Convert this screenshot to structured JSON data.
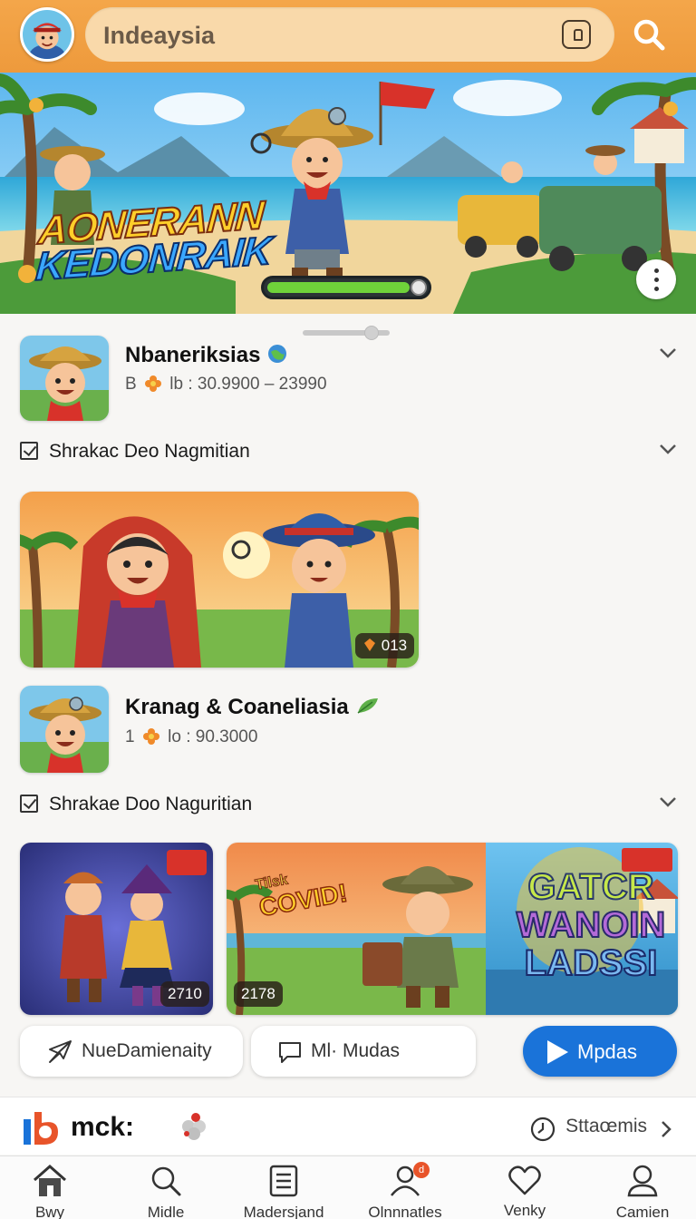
{
  "header": {
    "search_text": "Indeaysia"
  },
  "hero": {
    "title_line1": "AONERANN",
    "title_line2": "KEDONRAIK",
    "progress": 0.9
  },
  "items": [
    {
      "title": "Nbaneriksias",
      "meta_prefix": "B",
      "meta_value": "lb : 30.9900 – 23990",
      "check_label": "Shrakac Deo Nagmitian",
      "banner_badge": "013"
    },
    {
      "title": "Kranag & Coaneliasia",
      "meta_prefix": "1",
      "meta_value": "lo : 90.3000",
      "check_label": "Shrakae Doo Naguritian"
    }
  ],
  "gallery": [
    {
      "badge": "2710"
    },
    {
      "badge": "2178",
      "art_text": "COVID!",
      "art_small": "Tilsk"
    },
    {
      "art_text_1": "GATCR",
      "art_text_2": "WANOIN",
      "art_text_3": "LADSSI"
    }
  ],
  "actions": {
    "left_label": "NueDamienaity",
    "middle_label": "Ml· Mudas",
    "primary_label": "Mpdas"
  },
  "brand": {
    "name": "mck:",
    "status_link": "Sttaœmis"
  },
  "bottom_nav": [
    {
      "label": "Bwy",
      "icon": "home-icon"
    },
    {
      "label": "Midle",
      "icon": "search-icon"
    },
    {
      "label": "Madersjand",
      "icon": "document-icon"
    },
    {
      "label": "Olnnnatles",
      "icon": "person-icon",
      "badge": "d"
    },
    {
      "label": "Venky",
      "icon": "heart-icon"
    },
    {
      "label": "Camien",
      "icon": "user-icon"
    }
  ],
  "colors": {
    "header": "#ee9a3c",
    "primary": "#1a73d9",
    "progress": "#6fd23a"
  }
}
